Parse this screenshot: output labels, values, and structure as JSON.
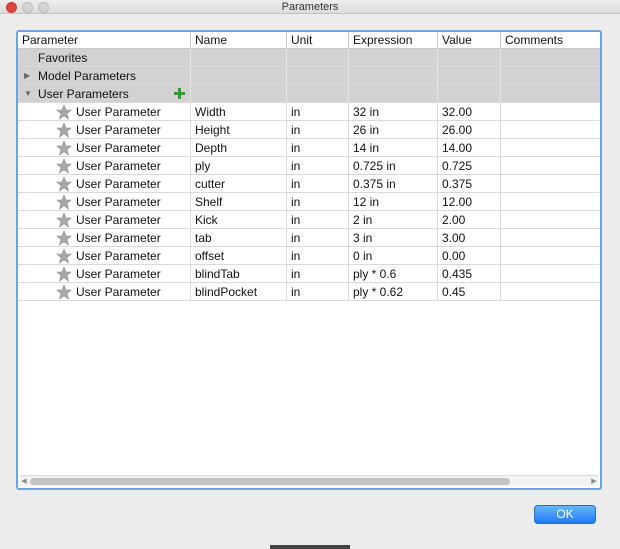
{
  "window": {
    "title": "Parameters"
  },
  "table": {
    "columns": [
      "Parameter",
      "Name",
      "Unit",
      "Expression",
      "Value",
      "Comments"
    ],
    "groups": {
      "favorites": "Favorites",
      "model": "Model Parameters",
      "user": "User Parameters"
    },
    "rows": [
      {
        "parameter": "User Parameter",
        "name": "Width",
        "unit": "in",
        "expression": "32 in",
        "value": "32.00",
        "comments": ""
      },
      {
        "parameter": "User Parameter",
        "name": "Height",
        "unit": "in",
        "expression": "26 in",
        "value": "26.00",
        "comments": ""
      },
      {
        "parameter": "User Parameter",
        "name": "Depth",
        "unit": "in",
        "expression": "14 in",
        "value": "14.00",
        "comments": ""
      },
      {
        "parameter": "User Parameter",
        "name": "ply",
        "unit": "in",
        "expression": "0.725 in",
        "value": "0.725",
        "comments": ""
      },
      {
        "parameter": "User Parameter",
        "name": "cutter",
        "unit": "in",
        "expression": "0.375 in",
        "value": "0.375",
        "comments": ""
      },
      {
        "parameter": "User Parameter",
        "name": "Shelf",
        "unit": "in",
        "expression": "12 in",
        "value": "12.00",
        "comments": ""
      },
      {
        "parameter": "User Parameter",
        "name": "Kick",
        "unit": "in",
        "expression": "2 in",
        "value": "2.00",
        "comments": ""
      },
      {
        "parameter": "User Parameter",
        "name": "tab",
        "unit": "in",
        "expression": "3 in",
        "value": "3.00",
        "comments": ""
      },
      {
        "parameter": "User Parameter",
        "name": "offset",
        "unit": "in",
        "expression": "0 in",
        "value": "0.00",
        "comments": ""
      },
      {
        "parameter": "User Parameter",
        "name": "blindTab",
        "unit": "in",
        "expression": "ply * 0.6",
        "value": "0.435",
        "comments": ""
      },
      {
        "parameter": "User Parameter",
        "name": "blindPocket",
        "unit": "in",
        "expression": "ply * 0.62",
        "value": "0.45",
        "comments": ""
      }
    ]
  },
  "buttons": {
    "ok": "OK"
  },
  "icons": {
    "star": "star-icon",
    "add": "plus-icon",
    "close": "close-icon"
  },
  "colors": {
    "accent": "#1c7cf4",
    "add_green": "#2e9e2e",
    "star_gray": "#a8a8a8",
    "close_red": "#e0443e"
  }
}
